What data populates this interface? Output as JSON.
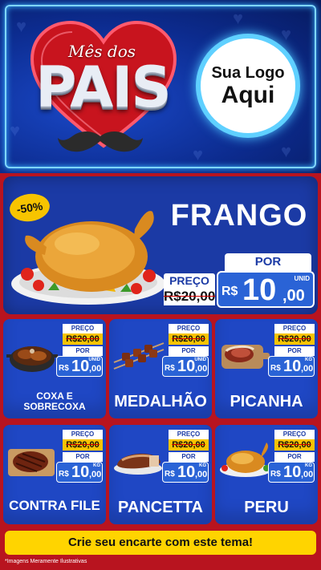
{
  "header": {
    "title_top": "Mês dos",
    "title_main": "PAIS",
    "logo_line1": "Sua Logo",
    "logo_line2": "Aqui"
  },
  "hero": {
    "discount_badge": "-50%",
    "product_name": "FRANGO",
    "old_label": "PREÇO",
    "old_price": "R$20,00",
    "new_label": "POR",
    "currency": "R$",
    "new_price_int": "10",
    "new_price_dec": ",00",
    "unit": "UNID",
    "image_icon": "roast-chicken-icon"
  },
  "cards": [
    {
      "name": "COXA E SOBRECOXA",
      "old_label": "PREÇO",
      "old_price": "R$20,00",
      "new_label": "POR",
      "currency": "R$",
      "price_int": "10",
      "price_dec": ",00",
      "unit": "UNID",
      "image_icon": "chicken-thigh-pot-icon"
    },
    {
      "name": "MEDALHÃO",
      "old_label": "PREÇO",
      "old_price": "R$20,00",
      "new_label": "POR",
      "currency": "R$",
      "price_int": "10",
      "price_dec": ",00",
      "unit": "UNID",
      "image_icon": "skewers-icon"
    },
    {
      "name": "PICANHA",
      "old_label": "PREÇO",
      "old_price": "R$20,00",
      "new_label": "POR",
      "currency": "R$",
      "price_int": "10",
      "price_dec": ",00",
      "unit": "KG",
      "image_icon": "steak-board-icon"
    },
    {
      "name": "CONTRA FILE",
      "old_label": "PREÇO",
      "old_price": "R$20,00",
      "new_label": "POR",
      "currency": "R$",
      "price_int": "10",
      "price_dec": ",00",
      "unit": "KG",
      "image_icon": "grilled-steak-icon"
    },
    {
      "name": "PANCETTA",
      "old_label": "PREÇO",
      "old_price": "R$20,00",
      "new_label": "POR",
      "currency": "R$",
      "price_int": "10",
      "price_dec": ",00",
      "unit": "KG",
      "image_icon": "pork-belly-icon"
    },
    {
      "name": "PERU",
      "old_label": "PREÇO",
      "old_price": "R$20,00",
      "new_label": "POR",
      "currency": "R$",
      "price_int": "10",
      "price_dec": ",00",
      "unit": "KG",
      "image_icon": "roast-turkey-icon"
    }
  ],
  "cta": "Crie seu encarte com este tema!",
  "footnote": "*Imagens Meramente Ilustrativas",
  "colors": {
    "header_blue": "#0c2b8e",
    "main_red": "#b8141f",
    "card_blue": "#1f47c4",
    "price_blue": "#2a63d6",
    "accent_yellow": "#ffd400",
    "neon_cyan": "#5fd0ff"
  }
}
